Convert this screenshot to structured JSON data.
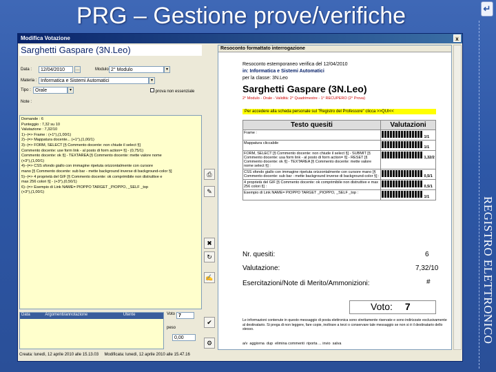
{
  "slide": {
    "title": "PRG – Gestione prove/verifiche",
    "side_label": "REGISTRO ELETTRONICO"
  },
  "window": {
    "title": "Modifica Votazione",
    "close_label": "x"
  },
  "left": {
    "student_name": "Sarghetti Gaspare  (3N.Leo)",
    "data_label": "Data :",
    "date_value": "12/04/2010",
    "modulo_label": "Modulo :",
    "modulo_value": "2° Modulo",
    "materia_label": "Materia :",
    "materia_value": "Informatica e Sistemi Automatici",
    "tipo_label": "Tipo :",
    "tipo_value": "Orale",
    "check_label": "prova non essenziale",
    "note_label": "Note :",
    "notes": [
      "Domande : 6",
      "Punteggio : 7,32 su 10",
      "Valutazione : 7,32/10",
      "1)--|=> Frame :  (+1°),(1,00/1)",
      "2)--|=> Mappatura docente... (+1°),(1,00/1)",
      "3)--|=> FORM, SELECT [§ Commento docente: non chiude il select §]",
      "Commento docente: use form link - al posto di form action= §] - (0,75/1)",
      "Commento docente: ok §] - TEXTAREA [§ Commento docente: mette valore nome",
      "(+3°),(1,00/1)",
      "4)--|=> CSS sfondo giallo con immagine ripetuta orizzontalmente con cursore",
      "mano [§ Commento docente: sub bar - mette background inverse di background-color §]",
      "5)--|=> 4 proprietà del GIF [§ Commento docente: ok comprimibile non distruttive e",
      "max 256 colori §] - (+3°),(0,50/1)",
      "6)--|=> Esempio di Link  NAME= PIOPPO TARGET _PIOPPO, _SELF _top",
      "(+3°),(1,00/1)"
    ],
    "bottom_head_data": "Data",
    "bottom_head_annot": "Argomenti/annotazione",
    "bottom_head_user": "Utente",
    "voto_label": "Voto",
    "voto_value": "7",
    "peso_label": "peso",
    "peso_value": "0,00"
  },
  "report": {
    "header": "Resoconto formattato interrogazione",
    "line1": "Resoconto estemporaneo verifica del 12/04/2010",
    "line2": "in: Informatica e Sistemi Automatici",
    "line3": "per la classe: 3N.Leo",
    "student": "Sarghetti Gaspare (3N.Leo)",
    "subline": "2° Modulo - Orale - Validità: 2° Quadrimestre - 1° RECUPERO (2° Prova)",
    "link_note": "Per accedere alla scheda personale sul \"Registro del Professore\" clicca >>QUI<<",
    "col_questions": "Testo quesiti",
    "col_scores": "Valutazioni",
    "questions": [
      {
        "text": "Frame :",
        "score": "1/1"
      },
      {
        "text": "Mappatura cliccabile",
        "score": "1/1"
      },
      {
        "text": "FORM, SELECT [§ Commento docente: non chiude il select §] - SUBMIT [§ Commento docente: usa form link - al posto di form action= §] - RESET [§ Commento docente: ok §] - TEXTAREA [§ Commento docente: mette valore nome select §] :",
        "score": "1,32/2"
      },
      {
        "text": "CSS sfondo giallo con immagine ripetuta orizzontalmente con cursore mano [§ Commento docente: sub bar - mette background inverse di background-color §] :",
        "score": "0,5/1"
      },
      {
        "text": "4 proprietà del GIF [§ Commento docente: ok comprimibile non distruttive e max 256 colori §] :",
        "score": "0,5/1"
      },
      {
        "text": "Esempio di Link  NAME= PIOPPO TARGET _PIOPPO, _SELF _top :",
        "score": "1/1"
      }
    ],
    "nr_quesiti_label": "Nr. quesiti:",
    "nr_quesiti_value": "6",
    "valutazione_label": "Valutazione:",
    "valutazione_value": "7,32/10",
    "esercitazioni_label": "Esercitazioni/Note di Merito/Ammonizioni:",
    "esercitazioni_value": "#",
    "voto_label": "Voto:",
    "voto_value": "7",
    "disclaimer": "Le informazioni contenute in questo messaggio di posta elettronica sono strettamente riservate e sono indirizzate esclusivamente al destinatario. Si prega di non leggere, fare copie, inoltrare a terzi o conservare tale messaggio se non si è il destinatario dello stesso."
  },
  "actions": {
    "a": "a/v",
    "b": "aggiorna",
    "c": "dup",
    "d": "elimina commenti",
    "e": "riporta ... invio",
    "f": "salva",
    "g": "riporta ... come evidenziato nel documento"
  },
  "status": {
    "created": "Creata: lunedì, 12 aprile 2010 alle 15.13.03",
    "modified": "Modificata: lunedì, 12 aprile 2010 alle 15.47.16"
  },
  "colors": {
    "bg": "#2d57a6",
    "titlebar": "#0a246a",
    "notes_bg": "#ffffcc",
    "link_bar": "#ffff00",
    "recovery_red": "#cc0000"
  }
}
